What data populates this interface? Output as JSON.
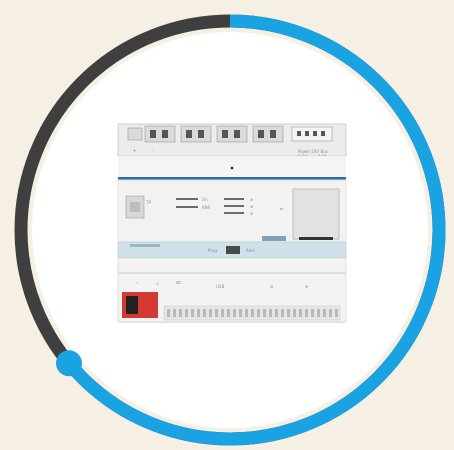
{
  "progress_ring": {
    "fraction_complete": 0.64,
    "colors": {
      "progress": "#1aa3e2",
      "remaining": "#3f3f3f",
      "background": "#f5f0e3",
      "inner": "#ffffff"
    }
  },
  "device": {
    "model": "TJA470",
    "brand": "hager",
    "labels": {
      "top_left_a": "+",
      "top_left_b": "-",
      "top_left_c": "24V DC",
      "top_left_d": "0.5 A",
      "power_title": "Power 24V Bus",
      "power_sub_a": "0.7A",
      "power_sub_b": "0.7A",
      "power_sub_c": "Gem.",
      "power_sub_d": "Mbus",
      "led_a": "On",
      "led_b": "KNX",
      "port_label": "TP",
      "btn_label": "Prog",
      "pin_label": "Alim",
      "usb_label": "USB"
    }
  }
}
